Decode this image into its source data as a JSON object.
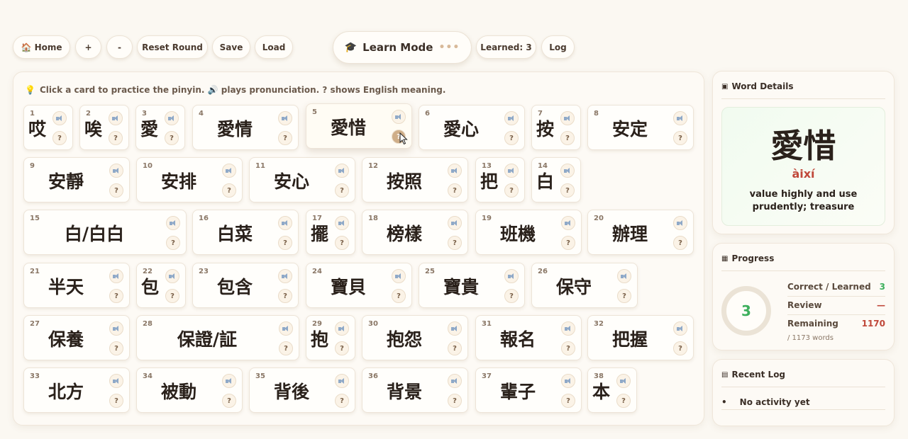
{
  "toolbar": {
    "home_icon": "house-icon",
    "home_label": "🏠 Home",
    "plus_label": "+",
    "minus_label": "-",
    "reset_label": "Reset Round",
    "save_label": "Save",
    "load_label": "Load",
    "mode_icon": "graduation-cap-icon",
    "mode_label": "Learn Mode",
    "mode_dots": "•••",
    "learned_label": "Learned: 3",
    "log_label": "Log"
  },
  "hint": {
    "icon": "lightbulb-icon",
    "text": "Click a card to practice the pinyin. 🔊 plays pronunciation. ? shows English meaning."
  },
  "cards": [
    {
      "num": "1",
      "word": "哎"
    },
    {
      "num": "2",
      "word": "唉"
    },
    {
      "num": "3",
      "word": "愛"
    },
    {
      "num": "4",
      "word": "愛情"
    },
    {
      "num": "5",
      "word": "愛惜"
    },
    {
      "num": "6",
      "word": "愛心"
    },
    {
      "num": "7",
      "word": "按"
    },
    {
      "num": "8",
      "word": "安定"
    },
    {
      "num": "9",
      "word": "安靜"
    },
    {
      "num": "10",
      "word": "安排"
    },
    {
      "num": "11",
      "word": "安心"
    },
    {
      "num": "12",
      "word": "按照"
    },
    {
      "num": "13",
      "word": "把"
    },
    {
      "num": "14",
      "word": "白"
    },
    {
      "num": "15",
      "word": "白/白白"
    },
    {
      "num": "16",
      "word": "白菜"
    },
    {
      "num": "17",
      "word": "擺"
    },
    {
      "num": "18",
      "word": "榜樣"
    },
    {
      "num": "19",
      "word": "班機"
    },
    {
      "num": "20",
      "word": "辦理"
    },
    {
      "num": "21",
      "word": "半天"
    },
    {
      "num": "22",
      "word": "包"
    },
    {
      "num": "23",
      "word": "包含"
    },
    {
      "num": "24",
      "word": "寶貝"
    },
    {
      "num": "25",
      "word": "寶貴"
    },
    {
      "num": "26",
      "word": "保守"
    },
    {
      "num": "27",
      "word": "保養"
    },
    {
      "num": "28",
      "word": "保證/証"
    },
    {
      "num": "29",
      "word": "抱"
    },
    {
      "num": "30",
      "word": "抱怨"
    },
    {
      "num": "31",
      "word": "報名"
    },
    {
      "num": "32",
      "word": "把握"
    },
    {
      "num": "33",
      "word": "北方"
    },
    {
      "num": "34",
      "word": "被動"
    },
    {
      "num": "35",
      "word": "背後"
    },
    {
      "num": "36",
      "word": "背景"
    },
    {
      "num": "37",
      "word": "輩子"
    },
    {
      "num": "38",
      "word": "本"
    }
  ],
  "card_buttons": {
    "sound": "speaker-icon",
    "question": "?"
  },
  "word_details": {
    "icon": "panel-icon",
    "title": "Word Details",
    "hanzi": "愛惜",
    "pinyin": "àixí",
    "meaning": "value highly and use prudently; treasure"
  },
  "progress": {
    "icon": "grid-icon",
    "title": "Progress",
    "ring_value": "3",
    "rows": [
      {
        "label": "Correct / Learned",
        "value": "3"
      },
      {
        "label": "Review",
        "value": "—"
      },
      {
        "label": "Remaining",
        "value": "1170"
      }
    ],
    "total": "/ 1173 words"
  },
  "recent_log": {
    "icon": "list-icon",
    "title": "Recent Log",
    "bullet": "•",
    "items": [
      "No activity yet"
    ]
  },
  "colors": {
    "background": "#fbf8f2",
    "accent_green": "#3daf5c",
    "accent_red": "#c0483a",
    "accent_tan": "#cfae88"
  }
}
